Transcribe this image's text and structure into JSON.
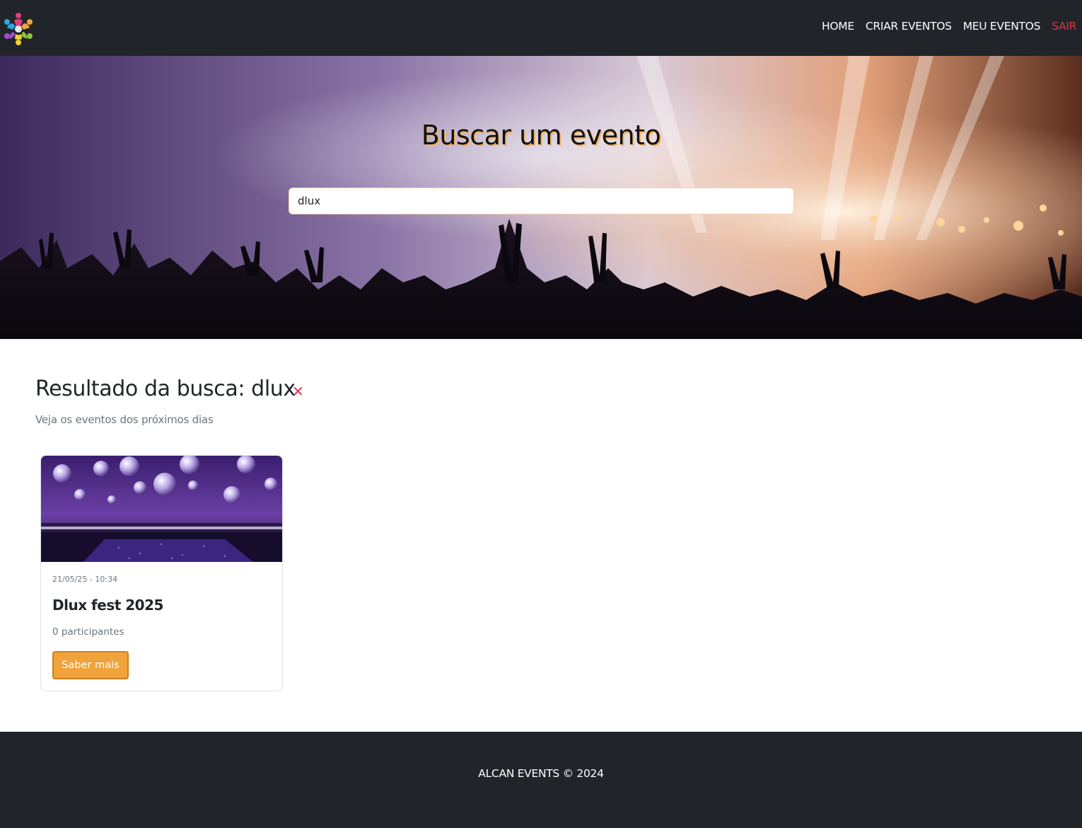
{
  "nav": {
    "logo_icon": "people-circle-logo-icon",
    "items": [
      "HOME",
      "CRIAR EVENTOS",
      "MEU EVENTOS",
      "SAIR"
    ]
  },
  "hero": {
    "title": "Buscar um evento",
    "search_value": "dlux",
    "background_icon": "concert-crowd-image"
  },
  "results": {
    "title": "Resultado da busca: dlux",
    "clear_label": "✕",
    "subtitle": "Veja os eventos dos próximos dias"
  },
  "events": [
    {
      "date": "21/05/25 - 10:34",
      "title": "Dlux fest 2025",
      "participants": "0 participantes",
      "button_label": "Saber mais",
      "image_icon": "disco-ball-party-image"
    }
  ],
  "footer": {
    "text": "ALCAN EVENTS © 2024"
  },
  "colors": {
    "navbar_bg": "#212529",
    "accent": "#f0a33a",
    "danger": "#dc3545"
  }
}
